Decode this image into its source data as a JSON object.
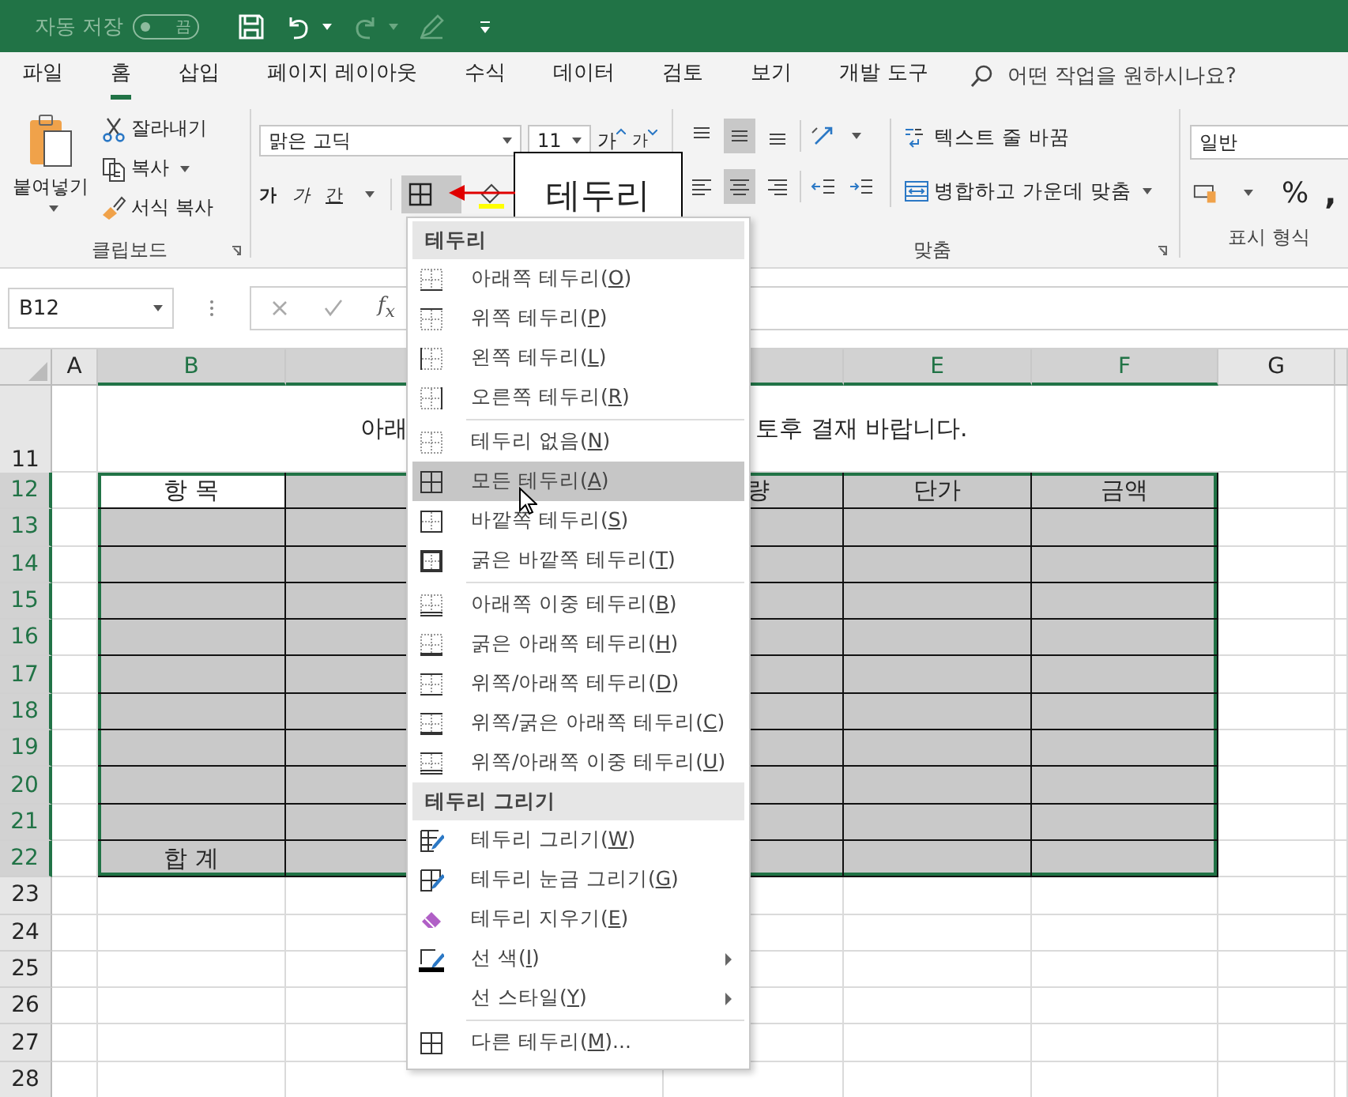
{
  "title_bar": {
    "autosave_label": "자동 저장",
    "autosave_toggle": {
      "text": "끔",
      "on": false
    }
  },
  "tabs": [
    {
      "label": "파일",
      "selected": false
    },
    {
      "label": "홈",
      "selected": true
    },
    {
      "label": "삽입",
      "selected": false
    },
    {
      "label": "페이지 레이아웃",
      "selected": false
    },
    {
      "label": "수식",
      "selected": false
    },
    {
      "label": "데이터",
      "selected": false
    },
    {
      "label": "검토",
      "selected": false
    },
    {
      "label": "보기",
      "selected": false
    },
    {
      "label": "개발 도구",
      "selected": false
    }
  ],
  "tell_me": {
    "placeholder": "어떤 작업을 원하시나요?"
  },
  "ribbon": {
    "clipboard": {
      "paste": "붙여넣기",
      "cut": "잘라내기",
      "copy": "복사",
      "format_painter": "서식 복사",
      "label": "클립보드"
    },
    "font": {
      "name": "맑은 고딕",
      "size": "11",
      "grow": "가",
      "shrink": "가",
      "bold": "가",
      "italic": "가",
      "underline": "간",
      "border_selected": true
    },
    "alignment": {
      "vertical": [
        {
          "kind": "top",
          "selected": false
        },
        {
          "kind": "middle",
          "selected": true
        },
        {
          "kind": "bottom",
          "selected": false
        }
      ],
      "horizontal": [
        {
          "kind": "left",
          "selected": false
        },
        {
          "kind": "center",
          "selected": true
        },
        {
          "kind": "right",
          "selected": false
        }
      ],
      "wrap": "텍스트 줄 바꿈",
      "merge": "병합하고 가운데 맞춤",
      "label": "맞춤"
    },
    "number": {
      "format": "일반",
      "percent": "%",
      "comma": ",",
      "label": "표시 형식"
    }
  },
  "formula_bar": {
    "name_box": "B12",
    "function_label": "f$_{x}$"
  },
  "sheet": {
    "columns": [
      {
        "label": "A",
        "selected": false
      },
      {
        "label": "B",
        "selected": true
      },
      {
        "selected": true
      },
      {
        "selected": true
      },
      {
        "label": "E",
        "selected": true
      },
      {
        "label": "F",
        "selected": true
      },
      {
        "label": "G",
        "selected": false
      }
    ],
    "rows": [
      {
        "number": "11",
        "selected": false,
        "title_left": "아래",
        "title_right": "토후 결재 바랍니다."
      },
      {
        "number": "12",
        "selected": true,
        "cells": [
          {
            "text": "항 목",
            "active": true
          },
          {},
          {
            "text": "량"
          },
          {
            "text": "단가"
          },
          {
            "text": "금액"
          }
        ]
      },
      {
        "number": "13",
        "selected": true
      },
      {
        "number": "14",
        "selected": true
      },
      {
        "number": "15",
        "selected": true
      },
      {
        "number": "16",
        "selected": true
      },
      {
        "number": "17",
        "selected": true
      },
      {
        "number": "18",
        "selected": true
      },
      {
        "number": "19",
        "selected": true
      },
      {
        "number": "20",
        "selected": true
      },
      {
        "number": "21",
        "selected": true
      },
      {
        "number": "22",
        "selected": true,
        "cells": [
          {
            "text": "합 계"
          }
        ]
      },
      {
        "number": "23",
        "selected": false
      },
      {
        "number": "24",
        "selected": false
      },
      {
        "number": "25",
        "selected": false
      },
      {
        "number": "26",
        "selected": false
      },
      {
        "number": "27",
        "selected": false
      },
      {
        "number": "28",
        "selected": false
      }
    ]
  },
  "callout": {
    "text": "테두리"
  },
  "border_menu": {
    "items": [
      {
        "kind": "header",
        "label": "테두리"
      },
      {
        "kind": "item",
        "label": "아래쪽 테두리(",
        "key": "O",
        "tail": ")",
        "selected": false
      },
      {
        "kind": "item",
        "label": "위쪽 테두리(",
        "key": "P",
        "tail": ")",
        "selected": false
      },
      {
        "kind": "item",
        "label": "왼쪽 테두리(",
        "key": "L",
        "tail": ")",
        "selected": false
      },
      {
        "kind": "item",
        "label": "오른쪽 테두리(",
        "key": "R",
        "tail": ")",
        "selected": false
      },
      {
        "kind": "separator"
      },
      {
        "kind": "item",
        "label": "테두리 없음(",
        "key": "N",
        "tail": ")",
        "selected": false
      },
      {
        "kind": "item",
        "label": "모든 테두리(",
        "key": "A",
        "tail": ")",
        "selected": true
      },
      {
        "kind": "item",
        "label": "바깥쪽 테두리(",
        "key": "S",
        "tail": ")",
        "selected": false
      },
      {
        "kind": "item",
        "label": "굵은 바깥쪽 테두리(",
        "key": "T",
        "tail": ")",
        "selected": false
      },
      {
        "kind": "separator"
      },
      {
        "kind": "item",
        "label": "아래쪽 이중 테두리(",
        "key": "B",
        "tail": ")",
        "selected": false
      },
      {
        "kind": "item",
        "label": "굵은 아래쪽 테두리(",
        "key": "H",
        "tail": ")",
        "selected": false
      },
      {
        "kind": "item",
        "label": "위쪽/아래쪽 테두리(",
        "key": "D",
        "tail": ")",
        "selected": false
      },
      {
        "kind": "item",
        "label": "위쪽/굵은 아래쪽 테두리(",
        "key": "C",
        "tail": ")",
        "selected": false
      },
      {
        "kind": "item",
        "label": "위쪽/아래쪽 이중 테두리(",
        "key": "U",
        "tail": ")",
        "selected": false
      },
      {
        "kind": "header",
        "label": "테두리 그리기"
      },
      {
        "kind": "item",
        "label": "테두리 그리기(",
        "key": "W",
        "tail": ")",
        "selected": false
      },
      {
        "kind": "item",
        "label": "테두리 눈금 그리기(",
        "key": "G",
        "tail": ")",
        "selected": false
      },
      {
        "kind": "item",
        "label": "테두리 지우기(",
        "key": "E",
        "tail": ")",
        "selected": false
      },
      {
        "kind": "item",
        "label": "선 색(",
        "key": "I",
        "tail": ")",
        "selected": false,
        "submenu": true
      },
      {
        "kind": "item",
        "label": "선 스타일(",
        "key": "Y",
        "tail": ")",
        "selected": false,
        "submenu": true
      },
      {
        "kind": "separator"
      },
      {
        "kind": "item",
        "label": "다른 테두리(",
        "key": "M",
        "tail": ")...",
        "selected": false
      }
    ]
  }
}
